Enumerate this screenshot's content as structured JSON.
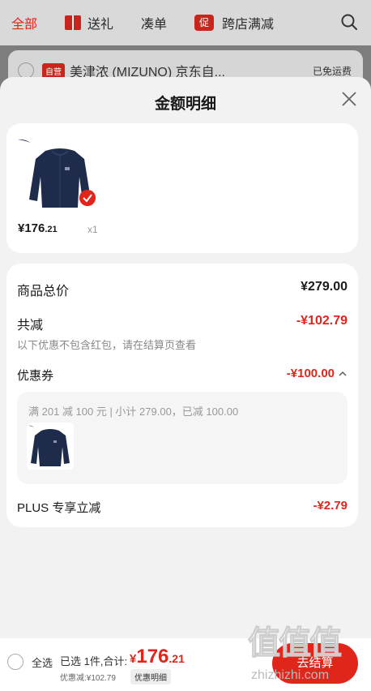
{
  "top_tabs": {
    "all": "全部",
    "gift": "送礼",
    "coudan": "凑单",
    "promo_badge": "促",
    "cross_store": "跨店满减"
  },
  "bg_store": {
    "badge": "自营",
    "name": "美津浓 (MIZUNO) 京东自...",
    "free_shipping": "已免运费"
  },
  "sheet": {
    "title": "金额明细"
  },
  "product": {
    "price_int": "¥176",
    "price_dec": ".21",
    "qty": "x1"
  },
  "breakdown": {
    "total_label": "商品总价",
    "total_value": "¥279.00",
    "reduction_label": "共减",
    "reduction_value": "-¥102.79",
    "note": "以下优惠不包含红包，请在结算页查看",
    "coupon_label": "优惠券",
    "coupon_value": "-¥100.00",
    "coupon_detail": "满 201 减 100 元 | 小计 279.00，已减 100.00",
    "plus_label": "PLUS 专享立减",
    "plus_value": "-¥2.79"
  },
  "bottom": {
    "select_all": "全选",
    "selected": "已选 1件,合计:",
    "sym": "¥",
    "total_int": "176",
    "total_dec": ".21",
    "discount": "优惠减:¥102.79",
    "detail": "优惠明细",
    "checkout": "去结算"
  },
  "watermark": {
    "chars": "值值值",
    "url": "zhizhizhi.com"
  },
  "colors": {
    "accent": "#e0261b",
    "sheet_bg": "#f2f2f2",
    "product": "#1f2b4a"
  },
  "icons": [
    "search-icon",
    "gift-icon",
    "close-icon",
    "checkmark-icon",
    "mizuno-logo-icon",
    "chevron-up-icon"
  ]
}
